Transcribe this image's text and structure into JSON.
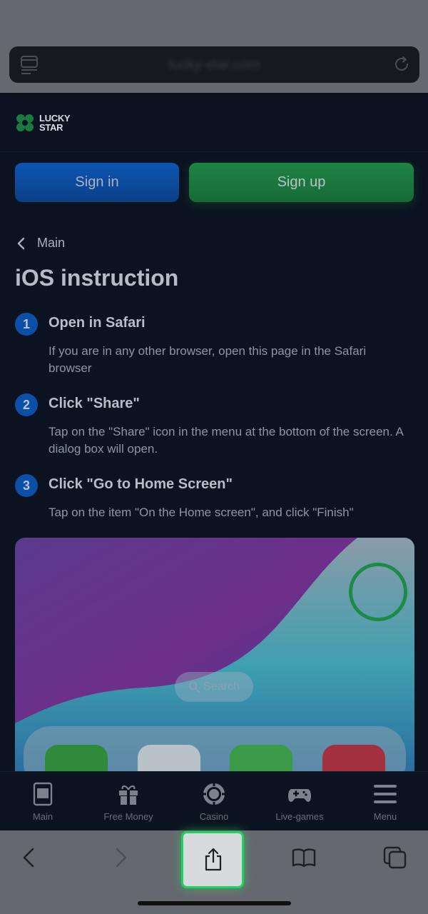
{
  "browser": {
    "url": "lucky-star.com",
    "icons": [
      "reader-icon",
      "reload-icon"
    ]
  },
  "header": {
    "logo_line1": "LUCKY",
    "logo_line2": "STAR",
    "signin_label": "Sign in",
    "signup_label": "Sign up"
  },
  "breadcrumb": {
    "label": "Main"
  },
  "page": {
    "title": "iOS instruction"
  },
  "steps": [
    {
      "num": "1",
      "heading": "Open in Safari",
      "desc": "If you are in any other browser, open this page in the Safari browser"
    },
    {
      "num": "2",
      "heading": "Click \"Share\"",
      "desc": "Tap on the \"Share\" icon in the menu at the bottom of the screen. A dialog box will open."
    },
    {
      "num": "3",
      "heading": "Click \"Go to Home Screen\"",
      "desc": "Tap on the item \"On the Home screen\", and click \"Finish\""
    }
  ],
  "illustration": {
    "search_label": "Search"
  },
  "site_nav": [
    {
      "label": "Main",
      "icon": "main-icon"
    },
    {
      "label": "Free Money",
      "icon": "gift-icon"
    },
    {
      "label": "Casino",
      "icon": "chip-icon"
    },
    {
      "label": "Live-games",
      "icon": "gamepad-icon"
    },
    {
      "label": "Menu",
      "icon": "hamburger-icon"
    }
  ],
  "toolbar": {
    "icons": [
      "back-icon",
      "forward-icon",
      "share-icon",
      "bookmarks-icon",
      "tabs-icon"
    ]
  },
  "colors": {
    "signin": "#0d56b3",
    "signup": "#1e8444",
    "highlight": "#1fd45e",
    "step_badge": "#0c4fa6"
  }
}
